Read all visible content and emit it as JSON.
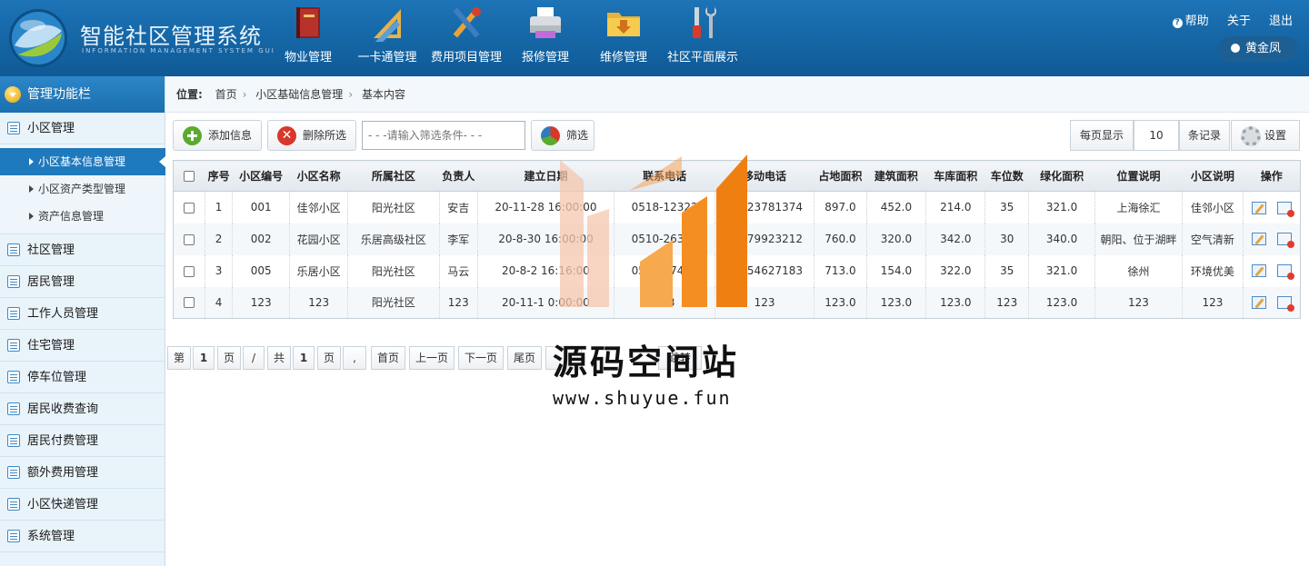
{
  "app": {
    "title": "智能社区管理系统",
    "subtitle": "INFORMATION MANAGEMENT SYSTEM GUI"
  },
  "topnav": [
    {
      "label": "物业管理",
      "icon": "book-icon"
    },
    {
      "label": "一卡通管理",
      "icon": "ruler-triangle-icon"
    },
    {
      "label": "费用项目管理",
      "icon": "tools-cross-icon"
    },
    {
      "label": "报修管理",
      "icon": "printer-icon"
    },
    {
      "label": "维修管理",
      "icon": "folder-download-icon"
    },
    {
      "label": "社区平面展示",
      "icon": "wrench-screwdriver-icon"
    }
  ],
  "toplinks": {
    "help": "帮助",
    "about": "关于",
    "logout": "退出",
    "user": "黄金凤"
  },
  "sidebar": {
    "header": "管理功能栏",
    "items": [
      {
        "label": "小区管理"
      },
      {
        "label": "社区管理"
      },
      {
        "label": "居民管理"
      },
      {
        "label": "工作人员管理"
      },
      {
        "label": "住宅管理"
      },
      {
        "label": "停车位管理"
      },
      {
        "label": "居民收费查询"
      },
      {
        "label": "居民付费管理"
      },
      {
        "label": "额外费用管理"
      },
      {
        "label": "小区快递管理"
      },
      {
        "label": "系统管理"
      }
    ],
    "subitems": [
      {
        "label": "小区基本信息管理",
        "active": true
      },
      {
        "label": "小区资产类型管理",
        "active": false
      },
      {
        "label": "资产信息管理",
        "active": false
      }
    ]
  },
  "breadcrumb": {
    "prefix": "位置:",
    "path": [
      "首页",
      "小区基础信息管理",
      "基本内容"
    ]
  },
  "toolbar": {
    "add": "添加信息",
    "delete": "删除所选",
    "filter_placeholder": "- - -请输入筛选条件- - -",
    "filter": "筛选",
    "per_page_label": "每页显示",
    "per_page_value": "10",
    "per_page_unit": "条记录",
    "settings": "设置"
  },
  "table": {
    "columns": [
      "序号",
      "小区编号",
      "小区名称",
      "所属社区",
      "负责人",
      "建立日期",
      "联系电话",
      "移动电话",
      "占地面积",
      "建筑面积",
      "车库面积",
      "车位数",
      "绿化面积",
      "位置说明",
      "小区说明",
      "操作"
    ],
    "rows": [
      [
        "1",
        "001",
        "佳邻小区",
        "阳光社区",
        "安吉",
        "20-11-28 16:00:00",
        "0518-12322",
        "13823781374",
        "897.0",
        "452.0",
        "214.0",
        "35",
        "321.0",
        "上海徐汇",
        "佳邻小区"
      ],
      [
        "2",
        "002",
        "花园小区",
        "乐居高级社区",
        "李军",
        "20-8-30 16:00:00",
        "0510-26378",
        "13979923212",
        "760.0",
        "320.0",
        "342.0",
        "30",
        "340.0",
        "朝阳、位于湖畔",
        "空气清新"
      ],
      [
        "3",
        "005",
        "乐居小区",
        "阳光社区",
        "马云",
        "20-8-2 16:16:00",
        "0512-27403",
        "15254627183",
        "713.0",
        "154.0",
        "322.0",
        "35",
        "321.0",
        "徐州",
        "环境优美"
      ],
      [
        "4",
        "123",
        "123",
        "阳光社区",
        "123",
        "20-11-1 0:00:00",
        "123",
        "123",
        "123.0",
        "123.0",
        "123.0",
        "123",
        "123.0",
        "123",
        "123"
      ]
    ]
  },
  "pager": {
    "di": "第",
    "page": "1",
    "ye": "页",
    "slash": "/",
    "gong": "共",
    "total": "1",
    "ye2": "页",
    "comma": ",",
    "first": "首页",
    "prev": "上一页",
    "next": "下一页",
    "last": "尾页",
    "jump": "跳转"
  },
  "watermark": {
    "title": "源码空间站",
    "url": "www.shuyue.fun"
  },
  "colors": {
    "header": "#1668a8",
    "sidebar_active": "#1f79bd",
    "watermark_orange": "#f5891a"
  }
}
